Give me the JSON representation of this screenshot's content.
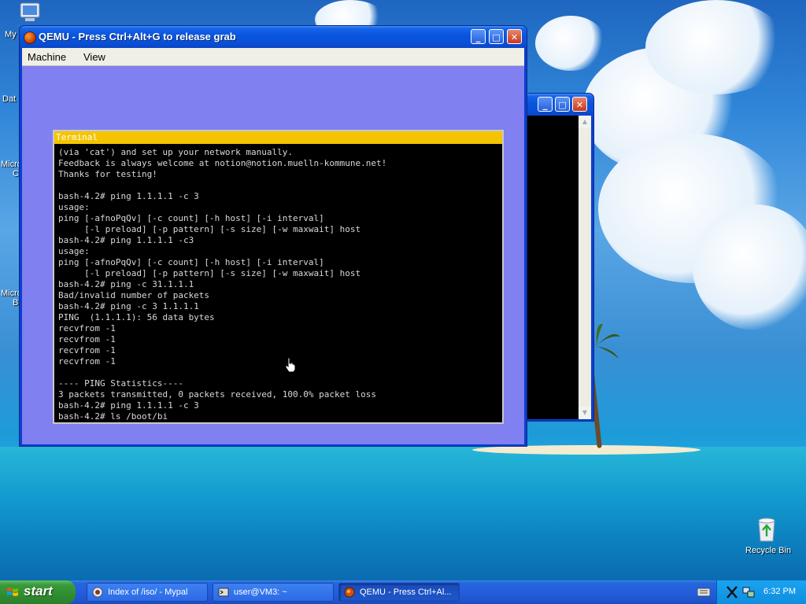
{
  "desktop": {
    "icons": [
      {
        "label": "My"
      },
      {
        "label": "Dat"
      },
      {
        "label": "Micro"
      },
      {
        "label": "C"
      },
      {
        "label": "Micro"
      },
      {
        "label": "B"
      },
      {
        "label": "Recycle Bin"
      }
    ]
  },
  "qemu_window": {
    "title": "QEMU - Press Ctrl+Alt+G to release grab",
    "menu": [
      "Machine",
      "View"
    ],
    "controls": {
      "minimize": "_",
      "maximize": "□",
      "close": "✕"
    },
    "background_color": "#8080f0"
  },
  "back_window": {
    "controls": {
      "minimize": "_",
      "maximize": "□",
      "close": "✕"
    },
    "scroll_up": "▲",
    "scroll_down": "▼"
  },
  "terminal": {
    "title": "Terminal",
    "title_color": "#f4c400",
    "lines": [
      "(via 'cat') and set up your network manually.",
      "Feedback is always welcome at notion@notion.muelln-kommune.net!",
      "Thanks for testing!",
      "",
      "bash-4.2# ping 1.1.1.1 -c 3",
      "usage:",
      "ping [-afnoPqQv] [-c count] [-h host] [-i interval]",
      "     [-l preload] [-p pattern] [-s size] [-w maxwait] host",
      "bash-4.2# ping 1.1.1.1 -c3",
      "usage:",
      "ping [-afnoPqQv] [-c count] [-h host] [-i interval]",
      "     [-l preload] [-p pattern] [-s size] [-w maxwait] host",
      "bash-4.2# ping -c 31.1.1.1",
      "Bad/invalid number of packets",
      "bash-4.2# ping -c 3 1.1.1.1",
      "PING  (1.1.1.1): 56 data bytes",
      "recvfrom -1",
      "recvfrom -1",
      "recvfrom -1",
      "recvfrom -1",
      "",
      "---- PING Statistics----",
      "3 packets transmitted, 0 packets received, 100.0% packet loss",
      "bash-4.2# ping 1.1.1.1 -c 3",
      "bash-4.2# ls /boot/bi_"
    ]
  },
  "taskbar": {
    "start_label": "start",
    "tasks": [
      {
        "label": "Index of /iso/ - Mypal",
        "icon": "browser-icon"
      },
      {
        "label": "user@VM3: ~",
        "icon": "terminal-icon"
      },
      {
        "label": "QEMU - Press Ctrl+Al...",
        "icon": "qemu-icon"
      }
    ],
    "clock": "6:32 PM"
  }
}
